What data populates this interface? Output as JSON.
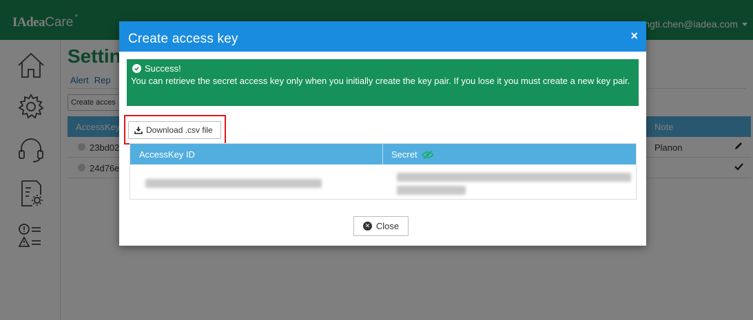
{
  "app": {
    "logo_brand": "IAdea",
    "logo_care": "Care",
    "logo_mark": "∘",
    "user_email": "ungti.chen@iadea.com"
  },
  "sidebar": {
    "items": [
      {
        "icon": "home-icon"
      },
      {
        "icon": "gear-icon"
      },
      {
        "icon": "headset-icon"
      },
      {
        "icon": "settings-document-icon"
      },
      {
        "icon": "alerts-icon"
      }
    ]
  },
  "page": {
    "title": "Settin",
    "tabs": [
      "Alert",
      "Rep"
    ],
    "create_button": "Create acces",
    "table": {
      "col_key": "AccessKey",
      "col_note": "Note",
      "rows": [
        {
          "key": "23bd02",
          "note": "Planon",
          "action_icon": "pencil-icon"
        },
        {
          "key": "24d76e",
          "note": "",
          "action_icon": "check-icon"
        }
      ]
    }
  },
  "modal": {
    "title": "Create access key",
    "close_symbol": "×",
    "alert": {
      "title": "Success!",
      "message": "You can retrieve the secret access key only when you initially create the key pair. If you lose it you must create a new key pair."
    },
    "download_label": "Download .csv file",
    "table": {
      "col_id": "AccessKey ID",
      "col_secret": "Secret"
    },
    "close_label": "Close",
    "colors": {
      "header": "#1a8ce0",
      "success": "#169159",
      "table_header": "#52aedf",
      "highlight": "#e3141b"
    }
  }
}
